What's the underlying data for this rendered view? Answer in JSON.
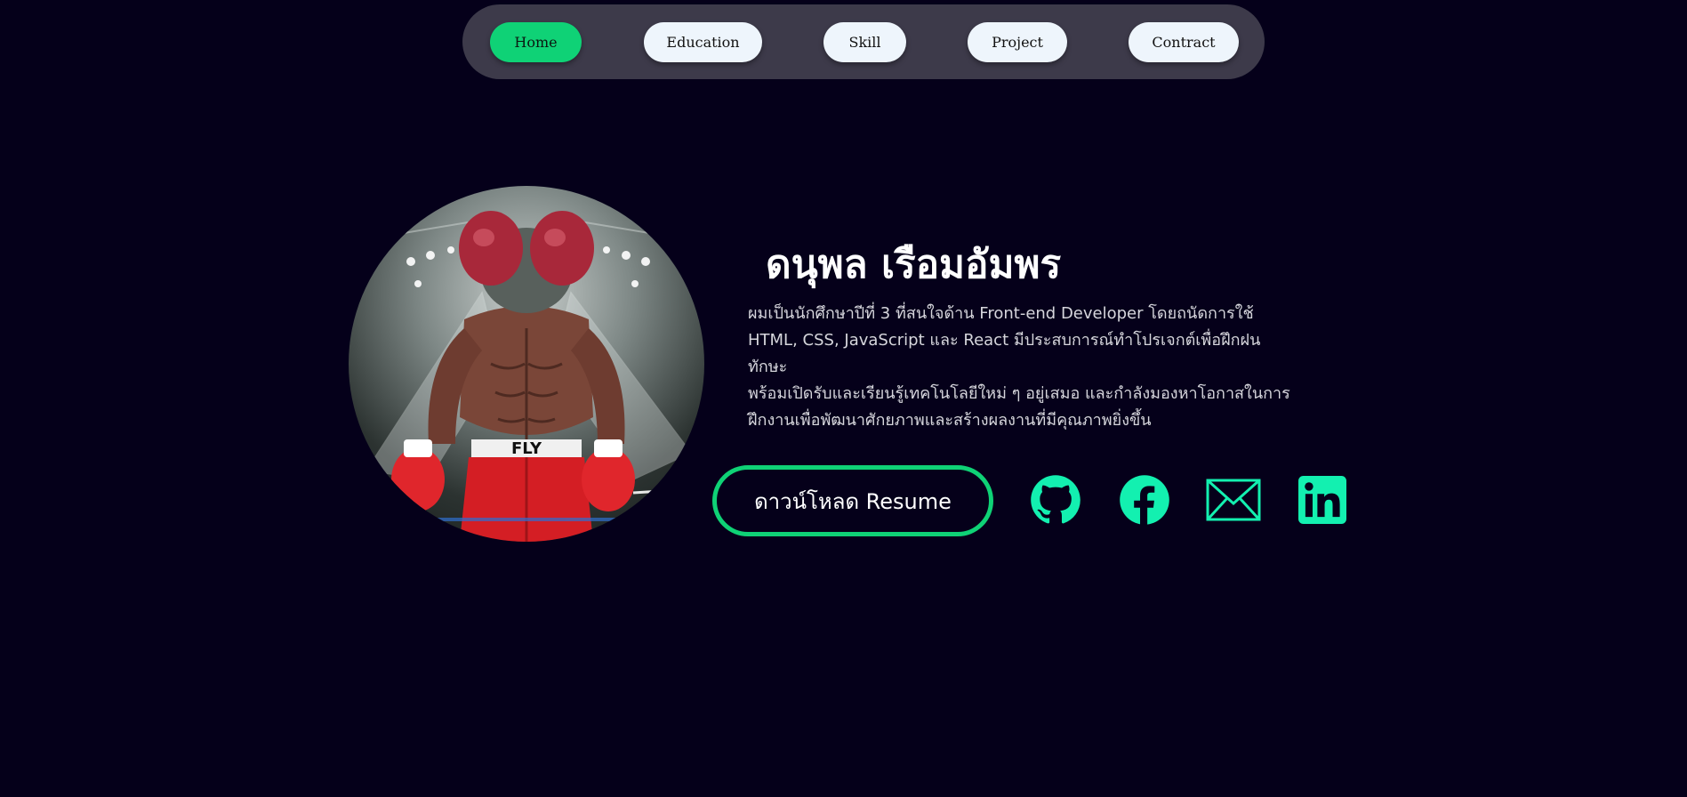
{
  "nav": {
    "items": [
      {
        "label": "Home",
        "active": true
      },
      {
        "label": "Education",
        "active": false
      },
      {
        "label": "Skill",
        "active": false
      },
      {
        "label": "Project",
        "active": false
      },
      {
        "label": "Contract",
        "active": false
      }
    ]
  },
  "profile": {
    "name": "ดนุพล เรือมอัมพร",
    "description_lines": [
      "ผมเป็นนักศึกษาปีที่ 3 ที่สนใจด้าน Front-end Developer โดยถนัดการใช้",
      "HTML, CSS, JavaScript และ React มีประสบการณ์ทำโปรเจกต์เพื่อฝึกฝนทักษะ",
      "พร้อมเปิดรับและเรียนรู้เทคโนโลยีใหม่ ๆ อยู่เสมอ และกำลังมองหาโอกาสในการ",
      "ฝึกงานเพื่อพัฒนาศักยภาพและสร้างผลงานที่มีคุณภาพยิ่งขึ้น"
    ],
    "avatar_lettering": "FLY"
  },
  "actions": {
    "resume_label": "ดาวน์โหลด Resume"
  },
  "social": {
    "icons": [
      "github-icon",
      "facebook-icon",
      "email-icon",
      "linkedin-icon"
    ]
  },
  "colors": {
    "background": "#05001a",
    "accent": "#0fd276",
    "icon": "#13f0b0",
    "nav_bg": "#3d3a4a",
    "nav_button": "#eef5fc"
  }
}
